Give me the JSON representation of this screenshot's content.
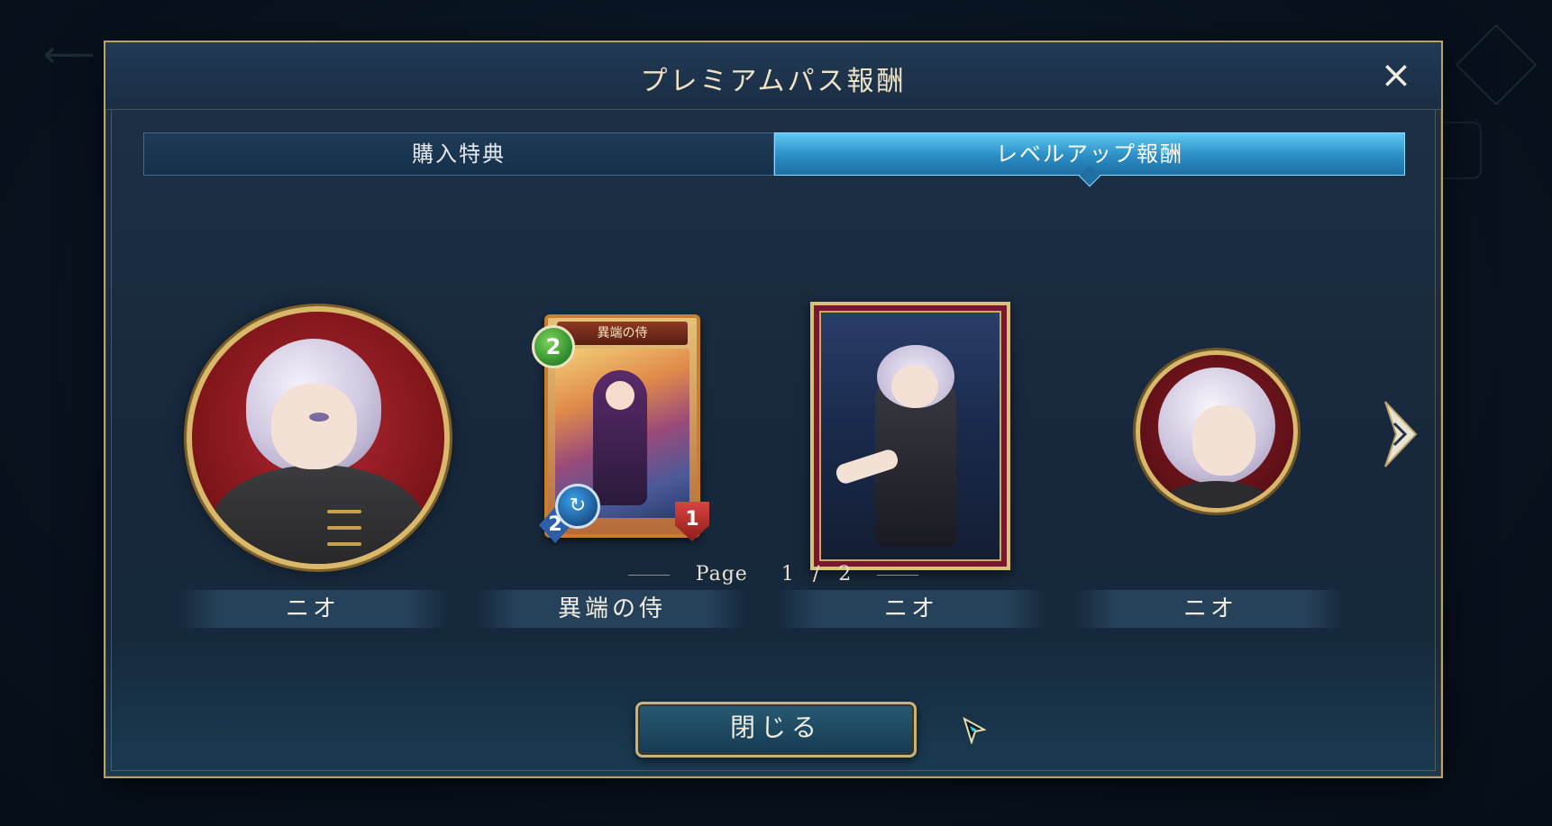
{
  "modal": {
    "title": "プレミアムパス報酬",
    "close_icon_label": "×",
    "close_button_label": "閉じる"
  },
  "tabs": [
    {
      "label": "購入特典",
      "active": false
    },
    {
      "label": "レベルアップ報酬",
      "active": true
    }
  ],
  "rewards": [
    {
      "type": "emblem",
      "name": "ニオ"
    },
    {
      "type": "card",
      "name": "異端の侍",
      "card_title": "異端の侍",
      "cost": "2",
      "attack": "2",
      "life": "1"
    },
    {
      "type": "sleeve",
      "name": "ニオ"
    },
    {
      "type": "icon",
      "name": "ニオ"
    }
  ],
  "pager": {
    "label": "Page",
    "current": "1",
    "separator": "/",
    "total": "2"
  },
  "colors": {
    "accent_gold": "#c8b37a",
    "tab_active": "#2a8dc4",
    "emblem_red": "#b52832"
  },
  "icons": {
    "close": "close-icon",
    "next": "chevron-right-icon",
    "evolve": "evolve-icon",
    "cursor": "pointer-cursor-icon"
  }
}
